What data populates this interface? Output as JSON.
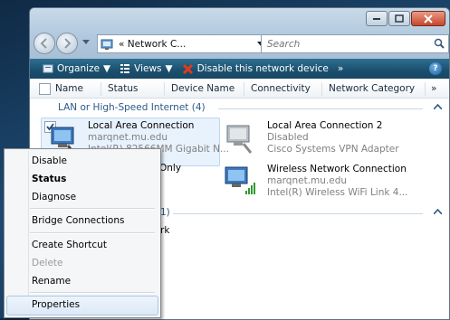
{
  "window": {
    "caption_buttons": [
      "minimize-icon",
      "maximize-icon",
      "close-icon"
    ],
    "nav": {
      "back_icon": "back-arrow-icon",
      "forward_icon": "forward-arrow-icon",
      "address_text": "« Network C...",
      "refresh_icon": "refresh-icon",
      "search_placeholder": "Search",
      "search_icon": "search-icon"
    }
  },
  "toolbar": {
    "organize_label": "Organize",
    "views_label": "Views",
    "disable_label": "Disable this network device",
    "more_label": "»",
    "help_icon": "help-icon"
  },
  "columns": [
    "Name",
    "Status",
    "Device Name",
    "Connectivity",
    "Network Category",
    "»"
  ],
  "groups": [
    {
      "label": "LAN or High-Speed Internet (4)"
    },
    {
      "label": "1)"
    }
  ],
  "items": [
    {
      "name": "Local Area Connection",
      "line1": "marqnet.mu.edu",
      "line2": "Intel(R) 82566MM Gigabit N..."
    },
    {
      "name": "Local Area Connection 2",
      "line1": "Disabled",
      "line2": "Cisco Systems VPN Adapter"
    },
    {
      "name": "Wireless Network Connection",
      "line1": "marqnet.mu.edu",
      "line2": "Intel(R) Wireless WiFi Link 4..."
    }
  ],
  "partial_texts": {
    "only": "Only",
    "rk": "rk"
  },
  "context_menu": {
    "disable": "Disable",
    "status": "Status",
    "diagnose": "Diagnose",
    "bridge": "Bridge Connections",
    "shortcut": "Create Shortcut",
    "delete": "Delete",
    "rename": "Rename",
    "properties": "Properties"
  },
  "colors": {
    "toolbar": "#1b4f6e",
    "group_header": "#2a5a8a",
    "disabled_text": "#9b9b9b",
    "selection": "#e8f2fc"
  }
}
